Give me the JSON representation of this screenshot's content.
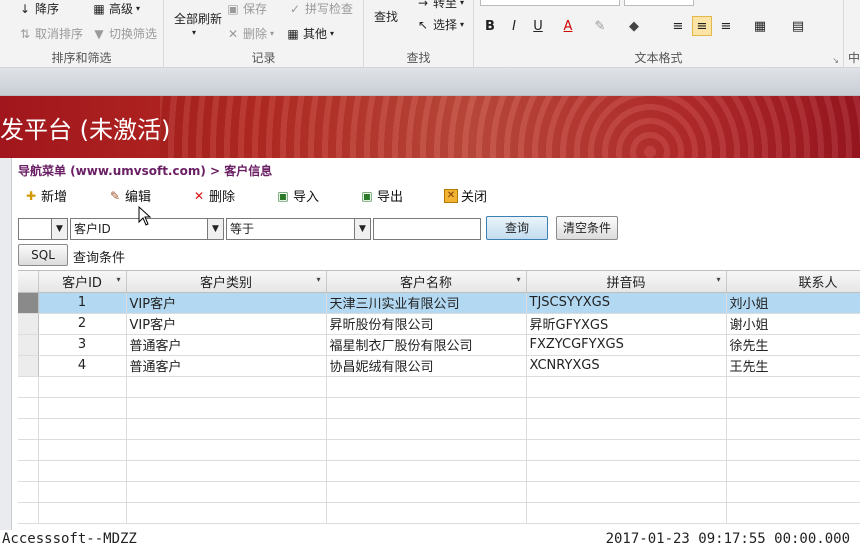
{
  "ribbon": {
    "sort_group": {
      "label": "排序和筛选",
      "descending": "降序",
      "advanced": "高级",
      "remove_sort": "取消排序",
      "toggle_filter": "切换筛选"
    },
    "records_group": {
      "label": "记录",
      "refresh_all": "全部刷新",
      "save": "保存",
      "delete": "删除",
      "spelling": "拼写检查",
      "other": "其他"
    },
    "find_group": {
      "label": "查找",
      "find": "查找",
      "goto": "转至",
      "select": "选择"
    },
    "text_group": {
      "label": "文本格式"
    },
    "next_group": {
      "label": "中"
    }
  },
  "banner": {
    "title": "发平台 (未激活)"
  },
  "breadcrumb": "导航菜单 (www.umvsoft.com) > 客户信息",
  "toolbar": {
    "add": "新增",
    "edit": "编辑",
    "delete": "删除",
    "import": "导入",
    "export": "导出",
    "close": "关闭"
  },
  "filter": {
    "field": "客户ID",
    "operator": "等于",
    "value": "",
    "query_button": "查询",
    "clear_button": "清空条件",
    "sql_button": "SQL",
    "condition_label": "查询条件"
  },
  "grid": {
    "columns": [
      "客户ID",
      "客户类别",
      "客户名称",
      "拼音码",
      "联系人"
    ],
    "rows": [
      {
        "id": "1",
        "type": "VIP客户",
        "name": "天津三川实业有限公司",
        "pinyin": "TJSCSYYXGS",
        "contact": "刘小姐"
      },
      {
        "id": "2",
        "type": "VIP客户",
        "name": "昇昕股份有限公司",
        "pinyin": "昇昕GFYXGS",
        "contact": "谢小姐"
      },
      {
        "id": "3",
        "type": "普通客户",
        "name": "福星制衣厂股份有限公司",
        "pinyin": "FXZYCGFYXGS",
        "contact": "徐先生"
      },
      {
        "id": "4",
        "type": "普通客户",
        "name": "协昌妮绒有限公司",
        "pinyin": "XCNRYXGS",
        "contact": "王先生"
      }
    ]
  },
  "status": {
    "left": "Accesssoft--MDZZ",
    "right": "2017-01-23 09:17:55 00:00.000"
  }
}
